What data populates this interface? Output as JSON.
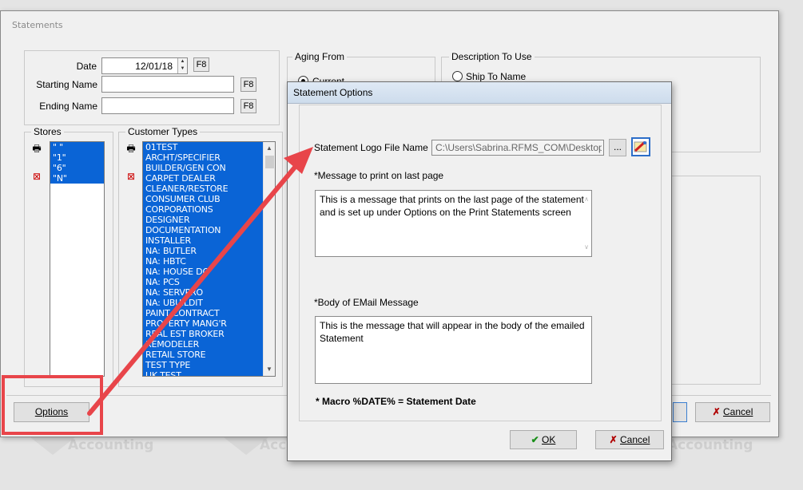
{
  "watermark": {
    "text": "Accounting"
  },
  "statements_window": {
    "title": "Statements",
    "date": {
      "label": "Date",
      "value": "12/01/18",
      "f8": "F8"
    },
    "starting_name": {
      "label": "Starting  Name",
      "value": "",
      "f8": "F8"
    },
    "ending_name": {
      "label": "Ending  Name",
      "value": "",
      "f8": "F8"
    },
    "stores": {
      "title": "Stores",
      "items": [
        "\" \"",
        "\"1\"",
        "\"6\"",
        "\"N\""
      ]
    },
    "customer_types": {
      "title": "Customer Types",
      "items": [
        "01TEST",
        "ARCHT/SPECIFIER",
        "BUILDER/GEN CON",
        "CARPET DEALER",
        "CLEANER/RESTORE",
        "CONSUMER CLUB",
        "CORPORATIONS",
        "DESIGNER",
        "DOCUMENTATION",
        "INSTALLER",
        "NA: BUTLER",
        "NA: HBTC",
        "NA: HOUSE DO",
        "NA: PCS",
        "NA: SERVPRO",
        "NA: UBUILDIT",
        "PAINT CONTRACT",
        "PROPERTY MANG'R",
        "REAL EST BROKER",
        "REMODELER",
        "RETAIL STORE",
        "TEST TYPE",
        "UK TEST"
      ]
    },
    "aging_from": {
      "title": "Aging From",
      "option": "Current"
    },
    "description_to_use": {
      "title": "Description To Use",
      "option": "Ship To Name"
    },
    "options_button": "Options",
    "cancel_button": "Cancel"
  },
  "statement_options": {
    "title": "Statement Options",
    "logo_label": "Statement Logo File Name",
    "logo_path": "C:\\Users\\Sabrina.RFMS_COM\\Desktop\\",
    "browse_label": "...",
    "last_page_label": "*Message to print on last page",
    "last_page_message": "This is a message that prints on the last page of the statement and is set up under Options on the Print Statements screen",
    "email_body_label": "*Body of EMail Message",
    "email_body_message": "This is the message that will appear in the body of the emailed Statement",
    "macro_note": "*  Macro %DATE% = Statement Date",
    "ok_button": "OK",
    "cancel_button": "Cancel"
  },
  "colors": {
    "selection": "#0a64d6",
    "annotation": "#e8454a"
  },
  "icons": [
    "calendar-spin-icon",
    "folder-icon",
    "logo-picker-icon",
    "check-icon",
    "x-icon",
    "printer-icon"
  ]
}
